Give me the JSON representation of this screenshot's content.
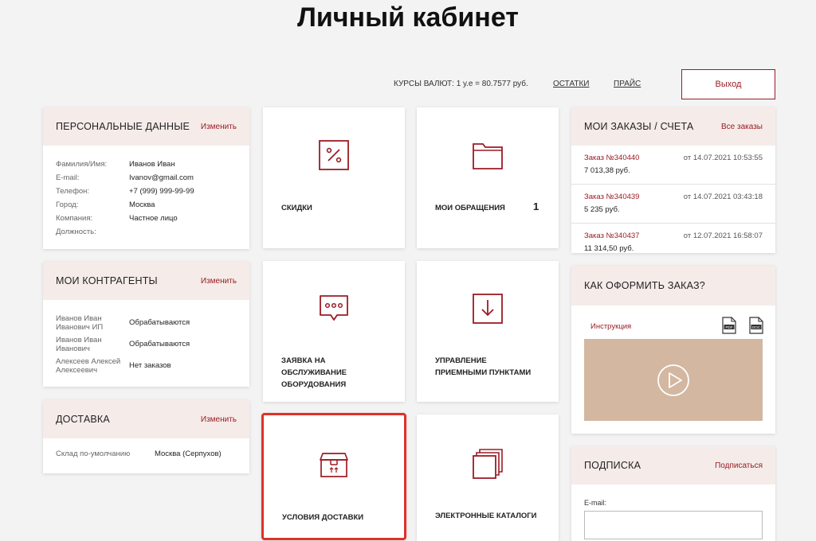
{
  "page": {
    "title": "Личный кабинет"
  },
  "topbar": {
    "rates": "КУРСЫ ВАЛЮТ: 1 у.е = 80.7577 руб.",
    "stock_link": "ОСТАТКИ",
    "price_link": "ПРАЙС",
    "logout_label": "Выход"
  },
  "personal": {
    "title": "ПЕРСОНАЛЬНЫЕ ДАННЫЕ",
    "edit_label": "Изменить",
    "rows": [
      {
        "k": "Фамилия/Имя:",
        "v": "Иванов Иван"
      },
      {
        "k": "E-mail:",
        "v": "Ivanov@gmail.com"
      },
      {
        "k": "Телефон:",
        "v": "+7 (999) 999-99-99"
      },
      {
        "k": "Город:",
        "v": "Москва"
      },
      {
        "k": "Компания:",
        "v": "Частное лицо"
      },
      {
        "k": "Должность:",
        "v": ""
      }
    ]
  },
  "contractors": {
    "title": "МОИ КОНТРАГЕНТЫ",
    "edit_label": "Изменить",
    "rows": [
      {
        "k": "Иванов Иван Иванович ИП",
        "v": "Обрабатываются"
      },
      {
        "k": "Иванов Иван Иванович",
        "v": "Обрабатываются"
      },
      {
        "k": "Алексеев Алексей Алексеевич",
        "v": "Нет заказов"
      }
    ]
  },
  "delivery": {
    "title": "ДОСТАВКА",
    "edit_label": "Изменить",
    "row": {
      "k": "Склад по-умолчанию",
      "v": "Москва (Серпухов)"
    }
  },
  "tiles": {
    "discounts": "СКИДКИ",
    "requests": "МОИ ОБРАЩЕНИЯ",
    "requests_count": "1",
    "service_1": "ЗАЯВКА НА",
    "service_2": "ОБСЛУЖИВАНИЕ",
    "service_3": "ОБОРУДОВАНИЯ",
    "points_1": "УПРАВЛЕНИЕ",
    "points_2": "ПРИЕМНЫМИ ПУНКТАМИ",
    "delivery_terms": "УСЛОВИЯ ДОСТАВКИ",
    "catalogs": "ЭЛЕКТРОННЫЕ КАТАЛОГИ"
  },
  "orders": {
    "title": "МОИ ЗАКАЗЫ / СЧЕТА",
    "all_label": "Все заказы",
    "items": [
      {
        "num": "Заказ №340440",
        "date": "от 14.07.2021 10:53:55",
        "sum": "7 013,38 руб."
      },
      {
        "num": "Заказ №340439",
        "date": "от 14.07.2021 03:43:18",
        "sum": "5 235 руб."
      },
      {
        "num": "Заказ №340437",
        "date": "от 12.07.2021 16:58:07",
        "sum": "11 314,50 руб."
      }
    ]
  },
  "howto": {
    "title": "КАК ОФОРМИТЬ ЗАКАЗ?",
    "instruction": "Инструкция",
    "pdf": "PDF",
    "doc": "DOC"
  },
  "subscribe": {
    "title": "ПОДПИСКА",
    "action": "Подписаться",
    "email_label": "E-mail:",
    "email_value": ""
  },
  "colors": {
    "accent": "#9b1c24",
    "header_bg": "#f5ece9",
    "video_bg": "#d3b7a0",
    "selected_border": "#e0302a"
  }
}
